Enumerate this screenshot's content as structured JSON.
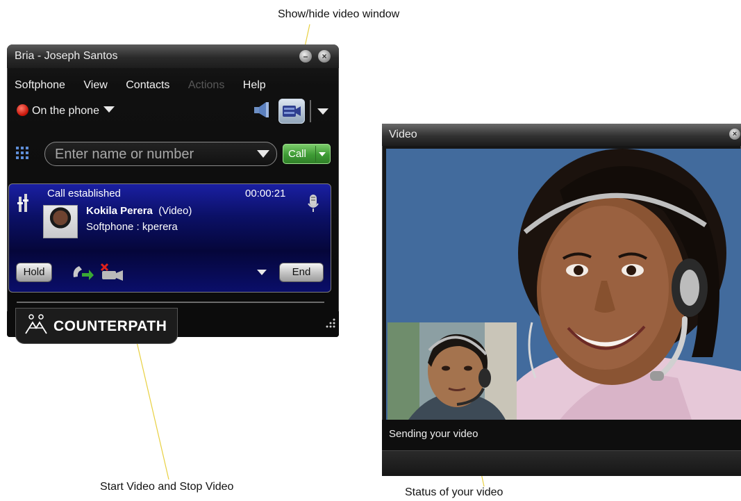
{
  "callouts": {
    "video_window": "Show/hide video window",
    "start_stop": "Start Video and Stop Video",
    "video_status": "Status of your video"
  },
  "bria": {
    "title": "Bria - Joseph Santos",
    "menu": [
      "Softphone",
      "View",
      "Contacts",
      "Actions",
      "Help"
    ],
    "menu_disabled": [
      "Actions"
    ],
    "presence": "On the phone",
    "search_placeholder": "Enter name or number",
    "call_button": "Call",
    "call": {
      "status": "Call established",
      "timer": "00:00:21",
      "contact_name": "Kokila Perera",
      "call_type": "(Video)",
      "account": "Softphone  :  kperera",
      "hold_button": "Hold",
      "end_button": "End"
    },
    "brand": "COUNTERPATH"
  },
  "video_window": {
    "title": "Video",
    "status": "Sending your video"
  },
  "colors": {
    "call_green": "#3d9a34",
    "call_panel_blue": "#0b1066",
    "video_background": "#416a9c",
    "callout_line": "#e8d040"
  },
  "icons": [
    "minimize-icon",
    "close-icon",
    "presence-icon",
    "speaker-icon",
    "video-icon",
    "dialpad-icon",
    "mute-icon",
    "microphone-icon",
    "transfer-icon",
    "start-video-icon",
    "resize-grip-icon",
    "counterpath-logo"
  ]
}
